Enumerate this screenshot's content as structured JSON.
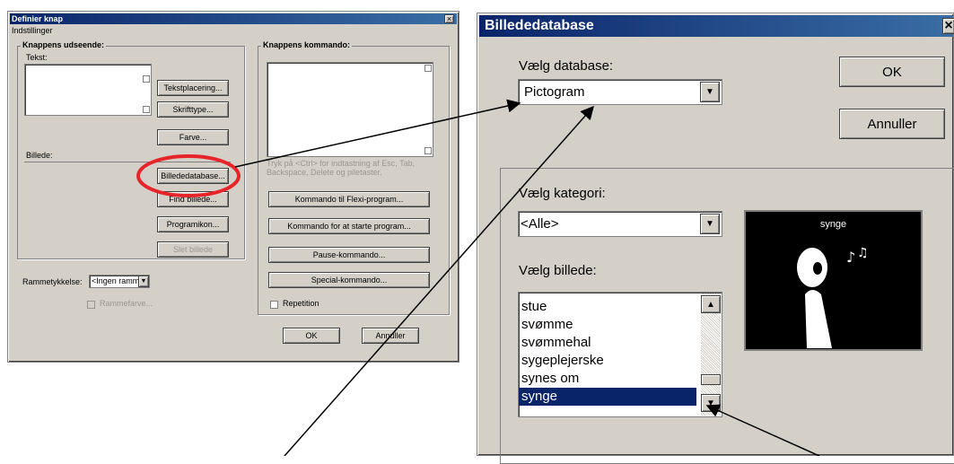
{
  "left_dialog": {
    "title": "Definier knap",
    "menu": "Indstillinger",
    "appearance_group": "Knappens udseende:",
    "text_label": "Tekst:",
    "text_placement_button": "Tekstplacering...",
    "font_button": "Skrifttype...",
    "color_button": "Farve...",
    "image_label": "Billede:",
    "image_db_button": "Billededatabase...",
    "find_image_button": "Find billede...",
    "program_icon_button": "Programikon...",
    "remove_image_button": "Slet billede",
    "border_label": "Rammetykkelse:",
    "border_value": "<Ingen ramme>",
    "border_color_checkbox": "Rammefarve...",
    "command_group": "Knappens kommando:",
    "command_hint": "Tryk på <Ctrl> for indtastning af Esc, Tab, Backspace, Delete og piletaster.",
    "flexi_command_button": "Kommando til Flexi-program...",
    "start_program_button": "Kommando for at starte program...",
    "pause_command_button": "Pause-kommando...",
    "special_command_button": "Special-kommando...",
    "repetition_checkbox": "Repetition",
    "ok_button": "OK",
    "cancel_button": "Annuller"
  },
  "right_dialog": {
    "title": "Billededatabase",
    "close_glyph": "×",
    "database_label": "Vælg database:",
    "database_value": "Pictogram",
    "ok_button": "OK",
    "cancel_button": "Annuller",
    "category_label": "Vælg kategori:",
    "category_value": "<Alle>",
    "image_label": "Vælg billede:",
    "image_list": [
      "stue",
      "svømme",
      "svømmehal",
      "sygeplejerske",
      "synes om",
      "synge"
    ],
    "selected_image": "synge",
    "preview_caption": "synge"
  },
  "icons": {
    "dropdown": "triangle-down",
    "scroll_up": "triangle-up",
    "scroll_down": "triangle-down",
    "close": "x-mark"
  },
  "colors": {
    "title_bar": "#0a246a",
    "selection": "#0a246a",
    "highlight_ellipse": "#e8242b",
    "dialog_face": "#d4d0c8"
  }
}
